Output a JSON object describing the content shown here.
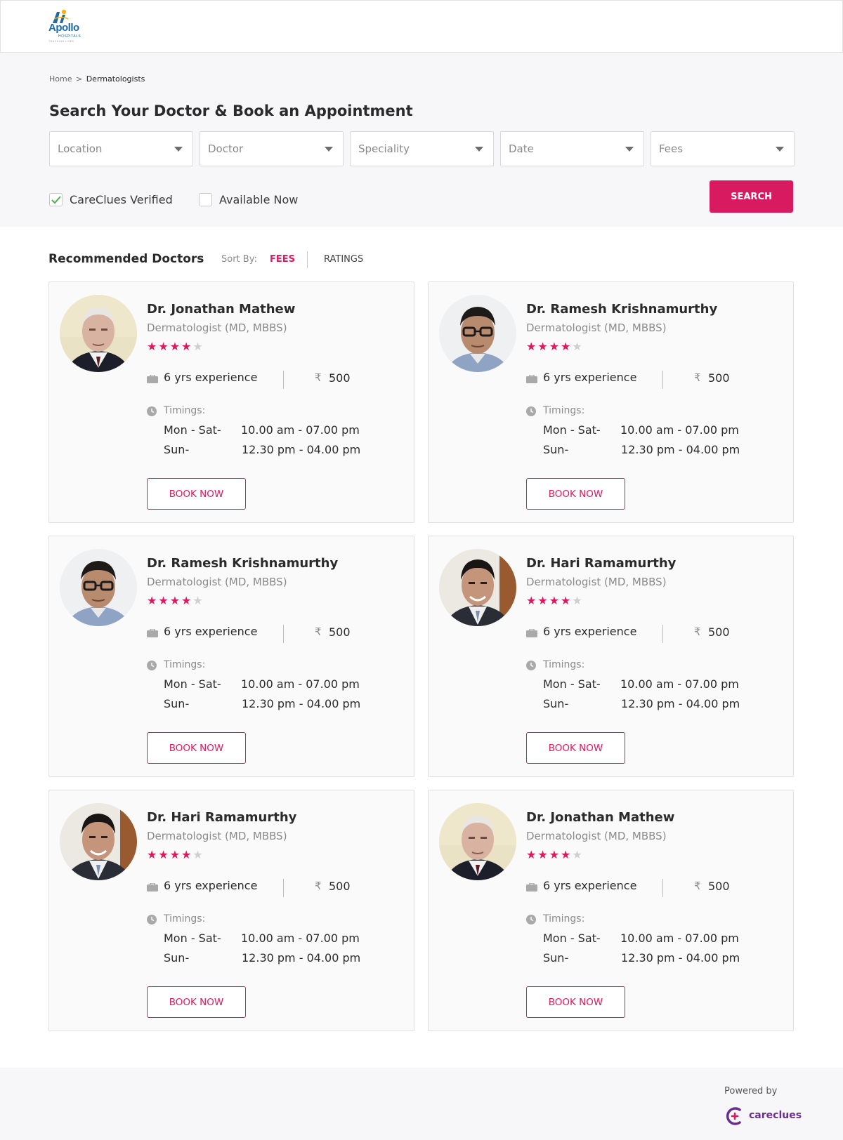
{
  "colors": {
    "accent": "#d81b60",
    "brand": "#1e6aa4",
    "careclues": "#6a2c91"
  },
  "logo": {
    "name": "Apollo",
    "sub": "HOSPITALS",
    "tag": "TOUCHING LIVES"
  },
  "breadcrumb": {
    "home": "Home",
    "separator": ">",
    "current": "Dermatologists"
  },
  "search": {
    "title": "Search Your Doctor & Book an Appointment",
    "filters": [
      {
        "placeholder": "Location",
        "icon": "chevron-down-icon"
      },
      {
        "placeholder": "Doctor",
        "icon": "chevron-down-icon"
      },
      {
        "placeholder": "Speciality",
        "icon": "chevron-down-icon"
      },
      {
        "placeholder": "Date",
        "icon": "chevron-down-icon"
      },
      {
        "placeholder": "Fees",
        "icon": "chevron-down-icon"
      }
    ],
    "checkboxes": [
      {
        "label": "CareClues Verified",
        "checked": true
      },
      {
        "label": "Available Now",
        "checked": false
      }
    ],
    "button_label": "SEARCH"
  },
  "recommended": {
    "title": "Recommended Doctors",
    "sort_label": "Sort By:",
    "sort_options": [
      {
        "label": "FEES",
        "active": true
      },
      {
        "label": "RATINGS",
        "active": false
      }
    ]
  },
  "doctors": [
    {
      "name": "Dr. Jonathan Mathew",
      "speciality": "Dermatologist (MD, MBBS)",
      "rating": 4,
      "rating_max": 5,
      "experience": "6 yrs experience",
      "currency": "₹",
      "fee": "500",
      "timings_label": "Timings:",
      "day1": "Mon - Sat-",
      "time1": "10.00 am - 07.00 pm",
      "day2": "Sun-",
      "time2": "12.30 pm - 04.00 pm",
      "button": "BOOK NOW",
      "avatar": "elderly-man"
    },
    {
      "name": "Dr. Ramesh Krishnamurthy",
      "speciality": "Dermatologist (MD, MBBS)",
      "rating": 4,
      "rating_max": 5,
      "experience": "6 yrs experience",
      "currency": "₹",
      "fee": "500",
      "timings_label": "Timings:",
      "day1": "Mon - Sat-",
      "time1": "10.00 am - 07.00 pm",
      "day2": "Sun-",
      "time2": "12.30 pm - 04.00 pm",
      "button": "BOOK NOW",
      "avatar": "man-glasses"
    },
    {
      "name": "Dr. Ramesh Krishnamurthy",
      "speciality": "Dermatologist (MD, MBBS)",
      "rating": 4,
      "rating_max": 5,
      "experience": "6 yrs experience",
      "currency": "₹",
      "fee": "500",
      "timings_label": "Timings:",
      "day1": "Mon - Sat-",
      "time1": "10.00 am - 07.00 pm",
      "day2": "Sun-",
      "time2": "12.30 pm - 04.00 pm",
      "button": "BOOK NOW",
      "avatar": "man-glasses"
    },
    {
      "name": "Dr. Hari Ramamurthy",
      "speciality": "Dermatologist (MD, MBBS)",
      "rating": 4,
      "rating_max": 5,
      "experience": "6 yrs experience",
      "currency": "₹",
      "fee": "500",
      "timings_label": "Timings:",
      "day1": "Mon - Sat-",
      "time1": "10.00 am - 07.00 pm",
      "day2": "Sun-",
      "time2": "12.30 pm - 04.00 pm",
      "button": "BOOK NOW",
      "avatar": "man-suit"
    },
    {
      "name": "Dr. Hari Ramamurthy",
      "speciality": "Dermatologist (MD, MBBS)",
      "rating": 4,
      "rating_max": 5,
      "experience": "6 yrs experience",
      "currency": "₹",
      "fee": "500",
      "timings_label": "Timings:",
      "day1": "Mon - Sat-",
      "time1": "10.00 am - 07.00 pm",
      "day2": "Sun-",
      "time2": "12.30 pm - 04.00 pm",
      "button": "BOOK NOW",
      "avatar": "man-suit"
    },
    {
      "name": "Dr. Jonathan Mathew",
      "speciality": "Dermatologist (MD, MBBS)",
      "rating": 4,
      "rating_max": 5,
      "experience": "6 yrs experience",
      "currency": "₹",
      "fee": "500",
      "timings_label": "Timings:",
      "day1": "Mon - Sat-",
      "time1": "10.00 am - 07.00 pm",
      "day2": "Sun-",
      "time2": "12.30 pm - 04.00 pm",
      "button": "BOOK NOW",
      "avatar": "elderly-man"
    }
  ],
  "footer": {
    "powered_by": "Powered by",
    "brand": "careclues"
  }
}
